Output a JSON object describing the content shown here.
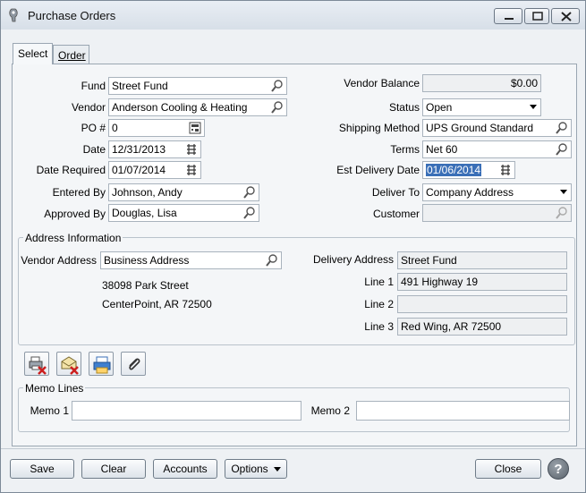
{
  "window": {
    "title": "Purchase Orders"
  },
  "tabs": [
    {
      "label": "Select"
    },
    {
      "label": "Order"
    }
  ],
  "form": {
    "fund": {
      "label": "Fund",
      "value": "Street Fund"
    },
    "vendor": {
      "label": "Vendor",
      "value": "Anderson Cooling & Heating"
    },
    "po": {
      "label": "PO #",
      "value": "0"
    },
    "date": {
      "label": "Date",
      "value": "12/31/2013"
    },
    "date_required": {
      "label": "Date Required",
      "value": "01/07/2014"
    },
    "entered_by": {
      "label": "Entered By",
      "value": "Johnson, Andy"
    },
    "approved_by": {
      "label": "Approved By",
      "value": "Douglas, Lisa"
    },
    "vendor_balance": {
      "label": "Vendor Balance",
      "value": "$0.00"
    },
    "status": {
      "label": "Status",
      "value": "Open"
    },
    "shipping_method": {
      "label": "Shipping Method",
      "value": "UPS Ground Standard"
    },
    "terms": {
      "label": "Terms",
      "value": "Net 60"
    },
    "est_delivery": {
      "label": "Est Delivery Date",
      "value": "01/06/2014"
    },
    "deliver_to": {
      "label": "Deliver To",
      "value": "Company Address"
    },
    "customer": {
      "label": "Customer",
      "value": ""
    }
  },
  "address": {
    "group_title": "Address Information",
    "vendor_address": {
      "label": "Vendor Address",
      "value": "Business Address"
    },
    "vendor_line1": "38098 Park Street",
    "vendor_line2": "CenterPoint, AR  72500",
    "delivery_address": {
      "label": "Delivery Address",
      "value": "Street Fund"
    },
    "line1": {
      "label": "Line 1",
      "value": "491 Highway 19"
    },
    "line2": {
      "label": "Line 2",
      "value": ""
    },
    "line3": {
      "label": "Line 3",
      "value": "Red Wing, AR  72500"
    }
  },
  "toolbar": [
    {
      "icon": "delete-print-icon"
    },
    {
      "icon": "delete-email-icon"
    },
    {
      "icon": "print-icon"
    },
    {
      "icon": "attachment-icon"
    }
  ],
  "memo": {
    "group_title": "Memo Lines",
    "memo1": {
      "label": "Memo 1",
      "value": ""
    },
    "memo2": {
      "label": "Memo 2",
      "value": ""
    }
  },
  "buttons": {
    "save": "Save",
    "clear": "Clear",
    "accounts": "Accounts",
    "options": "Options",
    "close": "Close",
    "help": "?"
  },
  "colors": {
    "selection": "#3a6fb7",
    "delete_red": "#cc1f1f"
  }
}
